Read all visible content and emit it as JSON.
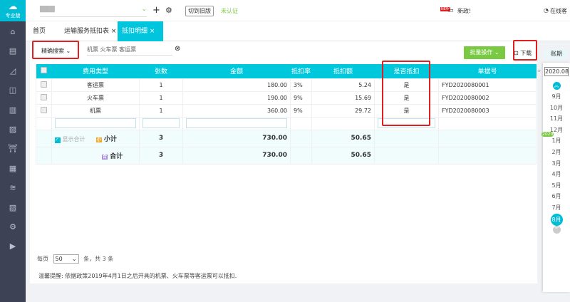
{
  "sidebar": {
    "logo_text": "专业版",
    "icons": [
      "home-icon",
      "invoice-icon",
      "chart-icon",
      "bag-icon",
      "building-icon",
      "report-icon",
      "shop-icon",
      "monitor-icon",
      "stack-icon",
      "document-icon",
      "settings-icon",
      "play-icon"
    ]
  },
  "topbar": {
    "company": "▇▇▇",
    "switch_old": "切到旧版",
    "unverified": "未认证",
    "news_badge": "NEW",
    "news": "新政!",
    "online": "在线客"
  },
  "tabs": [
    {
      "label": "首页"
    },
    {
      "label": "运输服务抵扣表"
    },
    {
      "label": "抵扣明细"
    }
  ],
  "toolbar": {
    "search_mode": "精确搜索",
    "search_value": "机票 火车票 客运票",
    "batch": "批量操作",
    "download": "下载"
  },
  "table": {
    "headers": [
      "费用类型",
      "张数",
      "金额",
      "抵扣率",
      "抵扣额",
      "是否抵扣",
      "单据号"
    ],
    "rows": [
      [
        "客运票",
        "1",
        "180.00",
        "3%",
        "5.24",
        "是",
        "FYD2020080001"
      ],
      [
        "火车票",
        "1",
        "190.00",
        "9%",
        "15.69",
        "是",
        "FYD2020080002"
      ],
      [
        "机票",
        "1",
        "360.00",
        "9%",
        "29.72",
        "是",
        "FYD2020080003"
      ]
    ],
    "show_total": "显示合计",
    "subtotal": {
      "label": "小计",
      "count": "3",
      "amount": "730.00",
      "deduct": "50.65"
    },
    "total": {
      "label": "合计",
      "count": "3",
      "amount": "730.00",
      "deduct": "50.65"
    }
  },
  "pagination": {
    "per_page": "每页",
    "size": "50",
    "suffix": "条，共 3 条"
  },
  "notice": "温馨提醒: 依据政策2019年4月1日之后开具的机票、火车票等客运票可以抵扣.",
  "period": {
    "label": "账期",
    "value": "2020.08",
    "year_badge": "2020",
    "months": [
      "9月",
      "10月",
      "11月",
      "12月",
      "1月",
      "2月",
      "3月",
      "4月",
      "5月",
      "6月",
      "7月",
      "8月"
    ],
    "selected": "8月"
  },
  "colors": {
    "accent": "#00c5dc",
    "green": "#7ac943",
    "sidebar": "#3d4354",
    "highlight": "#e02020"
  }
}
